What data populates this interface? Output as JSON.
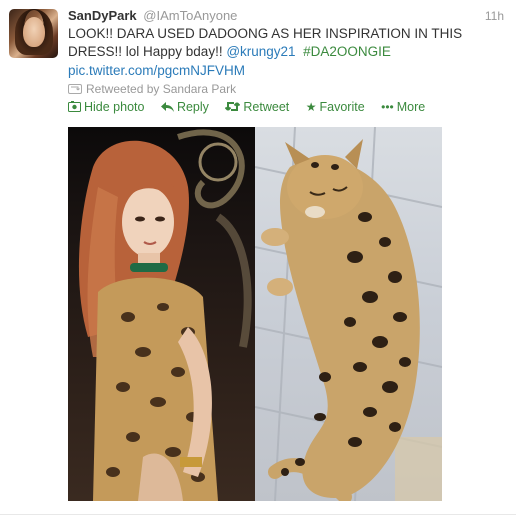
{
  "tweet": {
    "display_name": "SanDyPark",
    "handle": "@IAmToAnyone",
    "time": "11h",
    "text_part1": "LOOK!! DARA USED DADOONG AS HER INSPIRATION IN THIS DRESS!! lol Happy bday!! ",
    "mention": "@krungy21",
    "hashtag": "#DA2OONGIE",
    "pic_link": "pic.twitter.com/pgcmNJFVHM",
    "retweeted_by": "Retweeted by Sandara Park"
  },
  "actions": [
    {
      "label": "Hide photo",
      "icon": "photo-icon"
    },
    {
      "label": "Reply",
      "icon": "reply-arrow-icon"
    },
    {
      "label": "Retweet",
      "icon": "retweet-icon"
    },
    {
      "label": "Favorite",
      "icon": "star-icon"
    },
    {
      "label": "More",
      "icon": "more-dots-icon"
    }
  ],
  "colors": {
    "action_green": "#3b8a3e",
    "link_blue": "#2b7bb9",
    "muted_gray": "#999999"
  }
}
